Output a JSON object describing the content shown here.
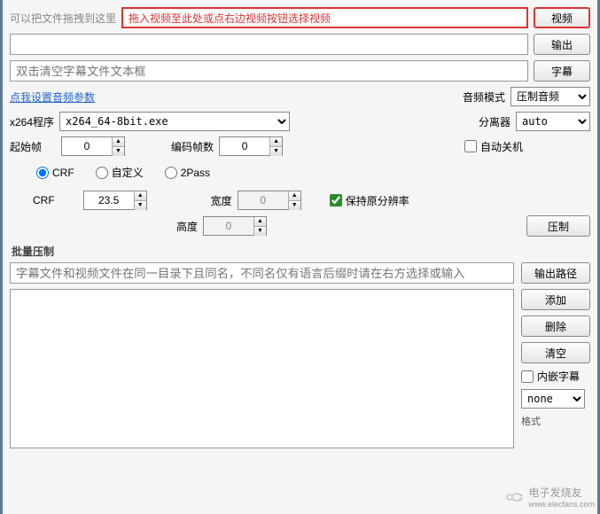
{
  "topRow": {
    "dragHint": "可以把文件拖拽到这里",
    "redHint": "拖入视频至此处或点右边视频按钮选择视频",
    "videoBtn": "视频"
  },
  "outputRow": {
    "outputBtn": "输出"
  },
  "subtitleRow": {
    "placeholder": "双击清空字幕文件文本框",
    "subtitleBtn": "字幕"
  },
  "audioLink": "点我设置音频参数",
  "audioMode": {
    "label": "音频模式",
    "value": "压制音频"
  },
  "x264": {
    "label": "x264程序",
    "value": "x264_64-8bit.exe"
  },
  "sep": {
    "label": "分离器",
    "value": "auto"
  },
  "startFrame": {
    "label": "起始帧",
    "value": "0"
  },
  "encFrames": {
    "label": "编码帧数",
    "value": "0"
  },
  "autoShutdown": "自动关机",
  "modes": {
    "crf": "CRF",
    "custom": "自定义",
    "twopass": "2Pass"
  },
  "crf": {
    "label": "CRF",
    "value": "23.5"
  },
  "width": {
    "label": "宽度",
    "value": "0"
  },
  "height": {
    "label": "高度",
    "value": "0"
  },
  "keepRes": "保持原分辨率",
  "encodeBtn": "压制",
  "batch": {
    "title": "批量压制",
    "hint": "字幕文件和视频文件在同一目录下且同名，不同名仅有语言后缀时请在右方选择或输入",
    "outputPath": "输出路径",
    "add": "添加",
    "del": "删除",
    "clear": "清空",
    "embedSub": "内嵌字幕",
    "subLang": "none",
    "format": "格式"
  },
  "watermark": {
    "text": "电子发烧友",
    "url": "www.elecfans.com"
  }
}
